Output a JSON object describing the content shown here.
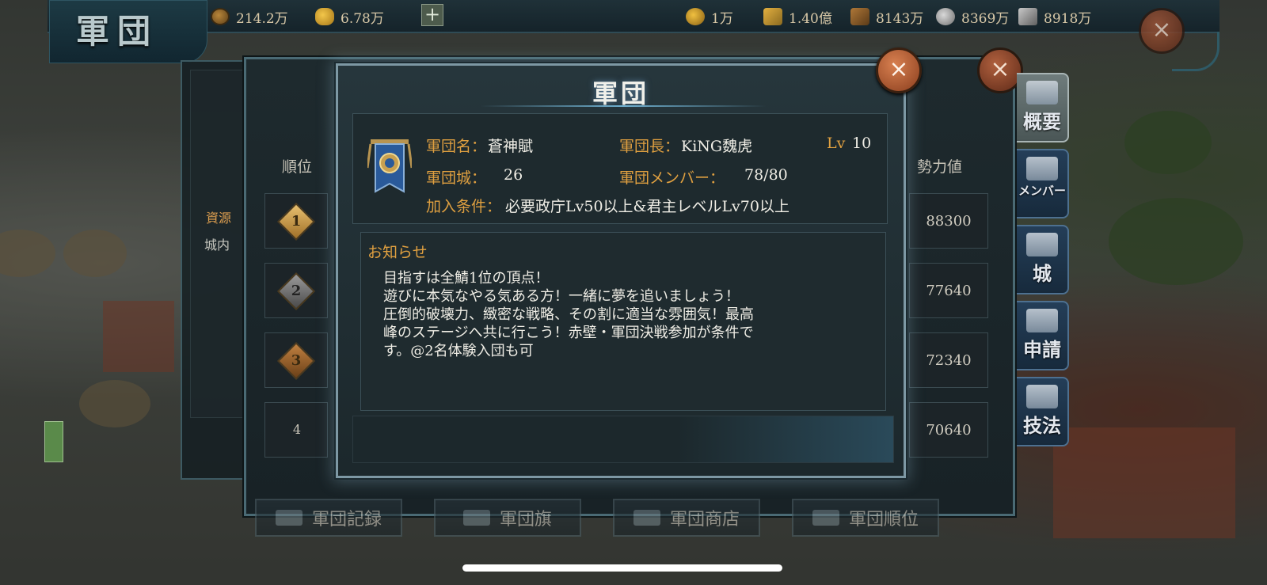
{
  "header": {
    "title": "軍団",
    "coins": "214.2万",
    "gold": "6.78万",
    "plus_label": "+",
    "resources": [
      {
        "icon": "rice-bag-icon",
        "value": "1万"
      },
      {
        "icon": "wheat-icon",
        "value": "1.40億"
      },
      {
        "icon": "wood-icon",
        "value": "8143万"
      },
      {
        "icon": "stone-icon",
        "value": "8369万"
      },
      {
        "icon": "iron-icon",
        "value": "8918万"
      }
    ],
    "close_label": "×"
  },
  "left_panel": {
    "line1": "資源",
    "line2": "城内"
  },
  "ranking": {
    "col_rank": "順位",
    "col_power": "勢力値",
    "rows": [
      {
        "rank": "1",
        "power": "88300"
      },
      {
        "rank": "2",
        "power": "77640"
      },
      {
        "rank": "3",
        "power": "72340"
      },
      {
        "rank": "4",
        "power": "70640"
      }
    ],
    "close_label": "×"
  },
  "side_tabs": [
    {
      "label": "概要",
      "icon": "scroll-icon"
    },
    {
      "label": "メンバー",
      "icon": "members-icon"
    },
    {
      "label": "城",
      "icon": "castle-icon"
    },
    {
      "label": "申請",
      "icon": "officer-icon"
    },
    {
      "label": "技法",
      "icon": "book-icon"
    }
  ],
  "bottom_buttons": [
    {
      "label": "軍団記録",
      "icon": "record-icon"
    },
    {
      "label": "軍団旗",
      "icon": "flag-icon"
    },
    {
      "label": "軍団商店",
      "icon": "shop-icon"
    },
    {
      "label": "軍団順位",
      "icon": "ranking-icon"
    }
  ],
  "modal": {
    "title": "軍団",
    "close_label": "×",
    "name_label": "軍団名：",
    "name_value": "蒼神賦",
    "leader_label": "軍団長：",
    "leader_value": "KiNG魏虎",
    "level_label": "Lv",
    "level_value": "10",
    "city_label": "軍団城：",
    "city_value": "26",
    "member_label": "軍団メンバー：",
    "member_value": "78/80",
    "join_label": "加入条件：",
    "join_value": "必要政庁Lv50以上&君主レベルLv70以上",
    "notice_title": "お知らせ",
    "notice_body": "目指すは全鯖1位の頂点！\n遊びに本気なやる気ある方！一緒に夢を追いましょう！\n圧倒的破壊力、緻密な戦略、その割に適当な雰囲気！最高\n峰のステージへ共に行こう！赤壁・軍団決戦参加が条件で\nす。@2名体験入団も可"
  },
  "colors": {
    "label_orange": "#e0a040",
    "modal_border": "#7d98a4",
    "close_button": "#c86a3e"
  }
}
